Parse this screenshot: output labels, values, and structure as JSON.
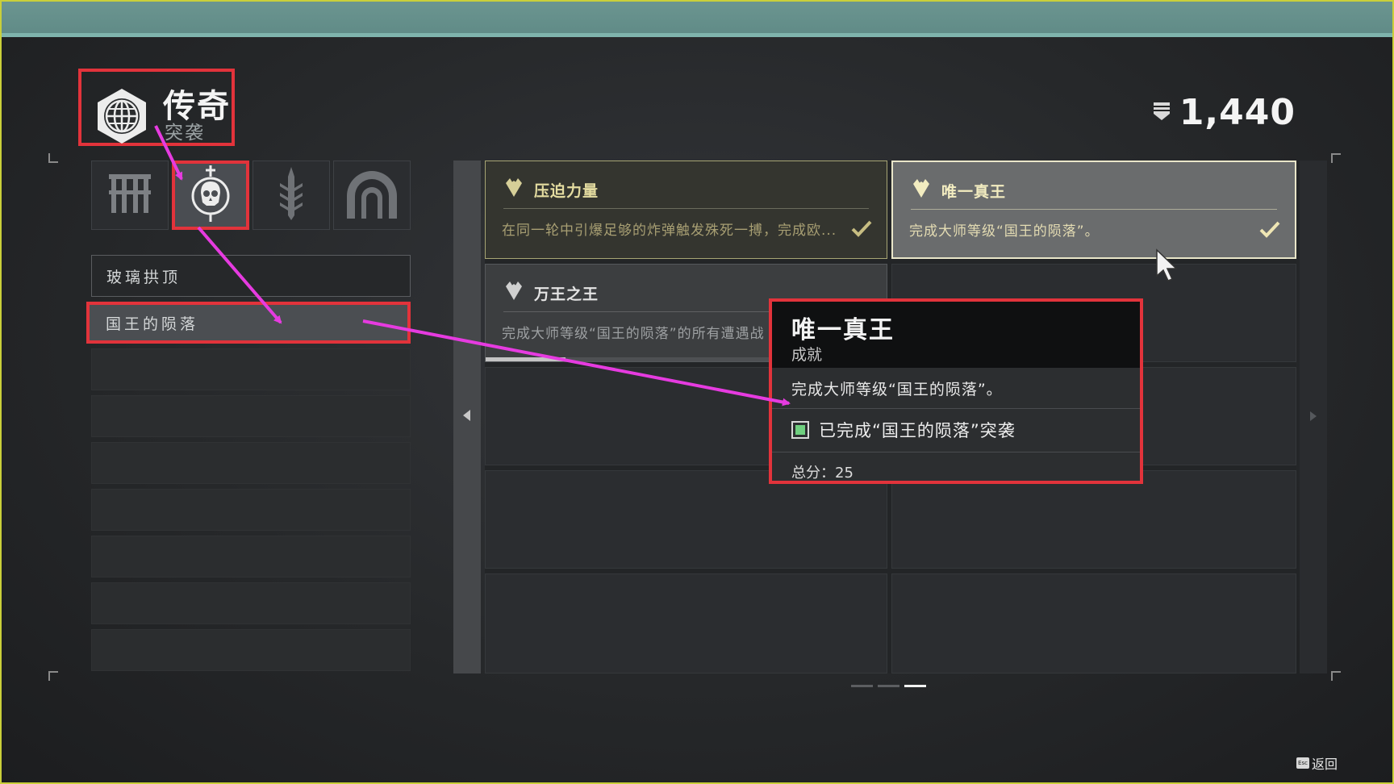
{
  "header": {
    "title": "传奇",
    "subtitle": "突袭",
    "currency_value": "1,440"
  },
  "tabs": [
    {
      "name": "tab-grid",
      "icon": "portcullis-icon",
      "active": false
    },
    {
      "name": "tab-raid",
      "icon": "skull-emblem-icon",
      "active": true
    },
    {
      "name": "tab-sword",
      "icon": "sword-icon",
      "active": false
    },
    {
      "name": "tab-arch",
      "icon": "arch-icon",
      "active": false
    }
  ],
  "sidebar": {
    "items": [
      {
        "label": "玻璃拱顶",
        "state": "outlined"
      },
      {
        "label": "国王的陨落",
        "state": "selected"
      }
    ]
  },
  "triumphs": [
    {
      "title": "压迫力量",
      "description": "在同一轮中引爆足够的炸弹触发殊死一搏，完成欧...",
      "completed": true,
      "icon": "triumph-icon"
    },
    {
      "title": "唯一真王",
      "description": "完成大师等级“国王的陨落”。",
      "completed": true,
      "icon": "triumph-icon"
    },
    {
      "title": "万王之王",
      "description": "完成大师等级“国王的陨落”的所有遭遇战",
      "completed": false,
      "progress": 0.2,
      "icon": "triumph-icon"
    }
  ],
  "tooltip": {
    "title": "唯一真王",
    "type": "成就",
    "description": "完成大师等级“国王的陨落”。",
    "objective": "已完成“国王的陨落”突袭",
    "objective_done": true,
    "score": "总分：25"
  },
  "pager": {
    "pages": 3,
    "current": 3
  },
  "footer": {
    "back_label": "返回",
    "back_key": "Esc"
  },
  "colors": {
    "highlight": "#e2333b",
    "annotation": "#e63be0",
    "complete": "#6fcf7f",
    "gold": "#e4dca0"
  }
}
